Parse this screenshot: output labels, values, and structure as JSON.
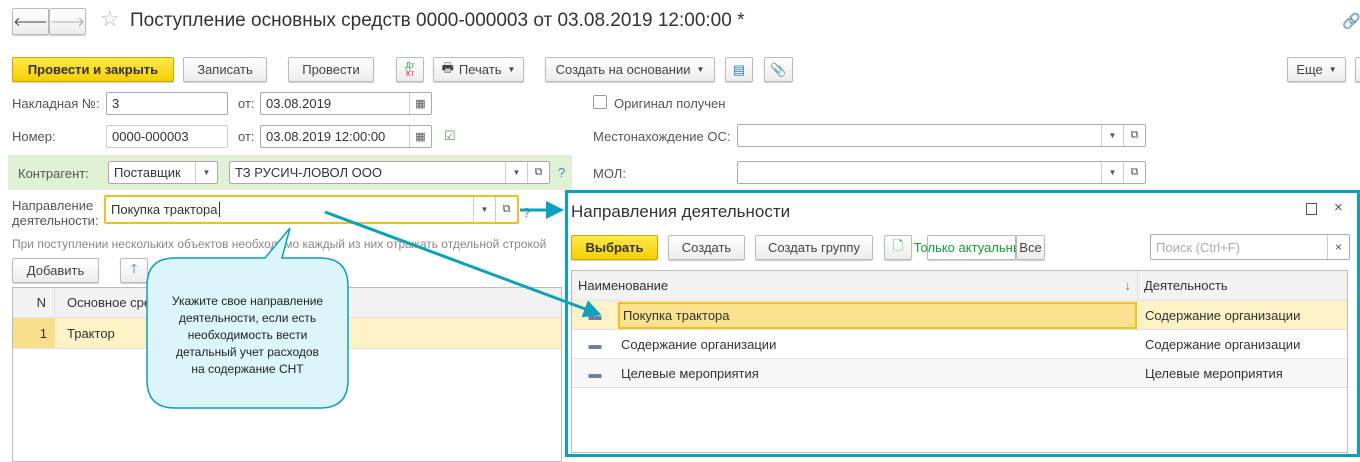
{
  "header": {
    "title": "Поступление основных средств 0000-000003 от 03.08.2019 12:00:00 *"
  },
  "toolbar": {
    "post_close": "Провести и закрыть",
    "save": "Записать",
    "post": "Провести",
    "dtkt_dt": "Дт",
    "dtkt_kt": "Кт",
    "print": "Печать",
    "create_based": "Создать на основании",
    "more": "Еще"
  },
  "form": {
    "invoice_label": "Накладная №:",
    "invoice_value": "3",
    "from_label": "от:",
    "invoice_date": "03.08.2019",
    "number_label": "Номер:",
    "number_value": "0000-000003",
    "number_date": "03.08.2019 12:00:00",
    "original_label": "Оригинал получен",
    "location_label": "Местонахождение ОС:",
    "location_value": "",
    "counterparty_label": "Контрагент:",
    "counterparty_type": "Поставщик",
    "counterparty_value": "ТЗ РУСИЧ-ЛОВОЛ ООО",
    "mol_label": "МОЛ:",
    "mol_value": "",
    "direction_label_1": "Направление",
    "direction_label_2": "деятельности:",
    "direction_value": "Покупка трактора",
    "help": "?",
    "hint": "При поступлении нескольких объектов необходимо каждый из них отражать отдельной строкой"
  },
  "table": {
    "add": "Добавить",
    "columns": [
      "N",
      "Основное средство"
    ],
    "rows": [
      {
        "n": "1",
        "name": "Трактор"
      }
    ]
  },
  "callout": {
    "lines": [
      "Укажите свое направление",
      "деятельности, если есть",
      "необходимость вести",
      "детальный учет расходов",
      "на содержание СНТ"
    ]
  },
  "popup": {
    "title": "Направления деятельности",
    "select": "Выбрать",
    "create": "Создать",
    "create_group": "Создать группу",
    "only_actual": "Только актуальные",
    "all": "Все",
    "search_placeholder": "Поиск (Ctrl+F)",
    "columns": [
      "Наименование",
      "Деятельность"
    ],
    "rows": [
      {
        "name": "Покупка трактора",
        "activity": "Содержание организации"
      },
      {
        "name": "Содержание организации",
        "activity": "Содержание организации"
      },
      {
        "name": "Целевые мероприятия",
        "activity": "Целевые мероприятия"
      }
    ]
  },
  "colors": {
    "accent": "#0aa0c0",
    "primary_button": "#f4d000",
    "selection": "#fbe59a"
  }
}
